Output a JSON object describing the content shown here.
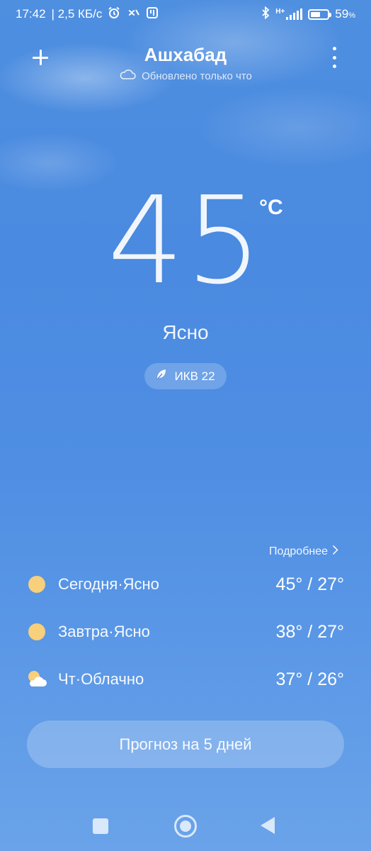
{
  "status_bar": {
    "time": "17:42",
    "network_speed": "| 2,5 КБ/с",
    "network_type": "H+",
    "battery_percent": "59",
    "battery_suffix": "%",
    "battery_level": 0.59
  },
  "header": {
    "city": "Ашхабад",
    "updated": "Обновлено только что"
  },
  "current": {
    "temperature": "45",
    "unit": "°C",
    "condition": "Ясно",
    "aqi_label": "ИКВ 22"
  },
  "forecast": {
    "more_label": "Подробнее",
    "days": [
      {
        "label": "Сегодня·Ясно",
        "range": "45° / 27°",
        "icon": "sun-icon"
      },
      {
        "label": "Завтра·Ясно",
        "range": "38° / 27°",
        "icon": "sun-icon"
      },
      {
        "label": "Чт·Облачно",
        "range": "37° / 26°",
        "icon": "partly-cloudy-icon"
      }
    ],
    "five_day_button": "Прогноз на 5 дней"
  },
  "colors": {
    "background_top": "#4f8fe0",
    "background_bottom": "#6aa3e9",
    "sun": "#f8cf7a"
  }
}
